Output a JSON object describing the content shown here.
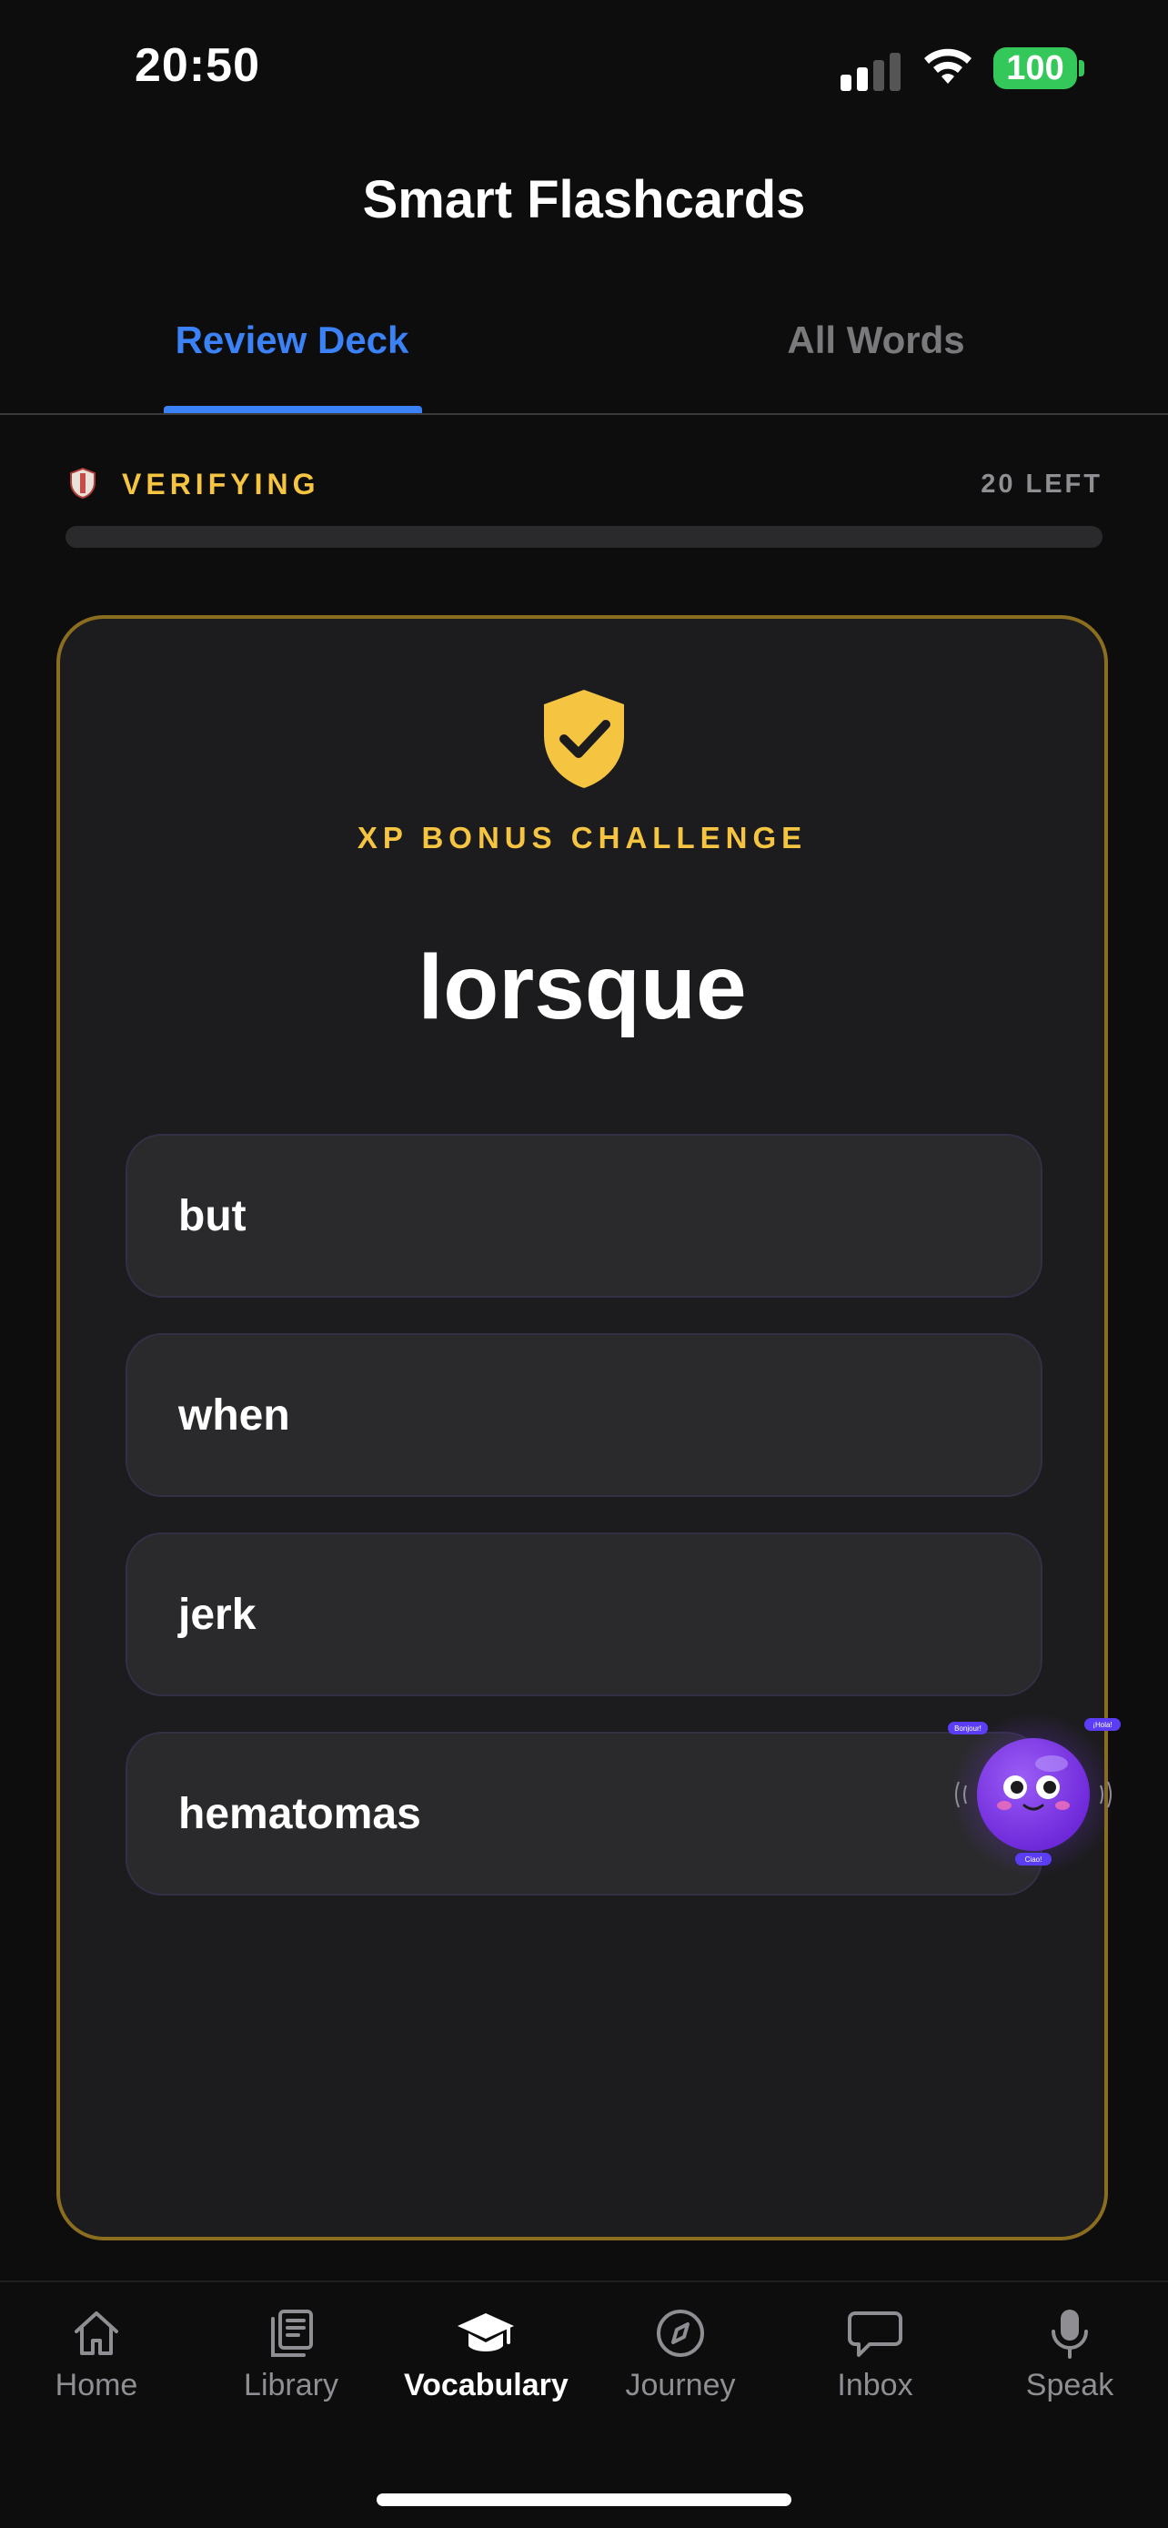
{
  "status_bar": {
    "time": "20:50",
    "battery": "100"
  },
  "header": {
    "title": "Smart Flashcards"
  },
  "tabs": [
    {
      "label": "Review Deck",
      "active": true
    },
    {
      "label": "All Words",
      "active": false
    }
  ],
  "progress": {
    "status_label": "VERIFYING",
    "remaining_label": "20 LEFT",
    "fill_fraction": 0.0
  },
  "card": {
    "badge_label": "XP BONUS CHALLENGE",
    "word": "lorsque",
    "options": [
      "but",
      "when",
      "jerk",
      "hematomas"
    ]
  },
  "mascot": {
    "bubbles": [
      "Bonjour!",
      "¡Hola!",
      "Ciao!"
    ]
  },
  "nav": [
    {
      "label": "Home",
      "icon": "home-icon"
    },
    {
      "label": "Library",
      "icon": "library-icon"
    },
    {
      "label": "Vocabulary",
      "icon": "graduation-cap-icon",
      "active": true
    },
    {
      "label": "Journey",
      "icon": "compass-icon"
    },
    {
      "label": "Inbox",
      "icon": "chat-bubble-icon"
    },
    {
      "label": "Speak",
      "icon": "microphone-icon"
    }
  ],
  "colors": {
    "accent_blue": "#3b82f6",
    "gold": "#f5c542",
    "card_border": "#8a6d1f",
    "mascot_purple": "#7c3aed"
  }
}
